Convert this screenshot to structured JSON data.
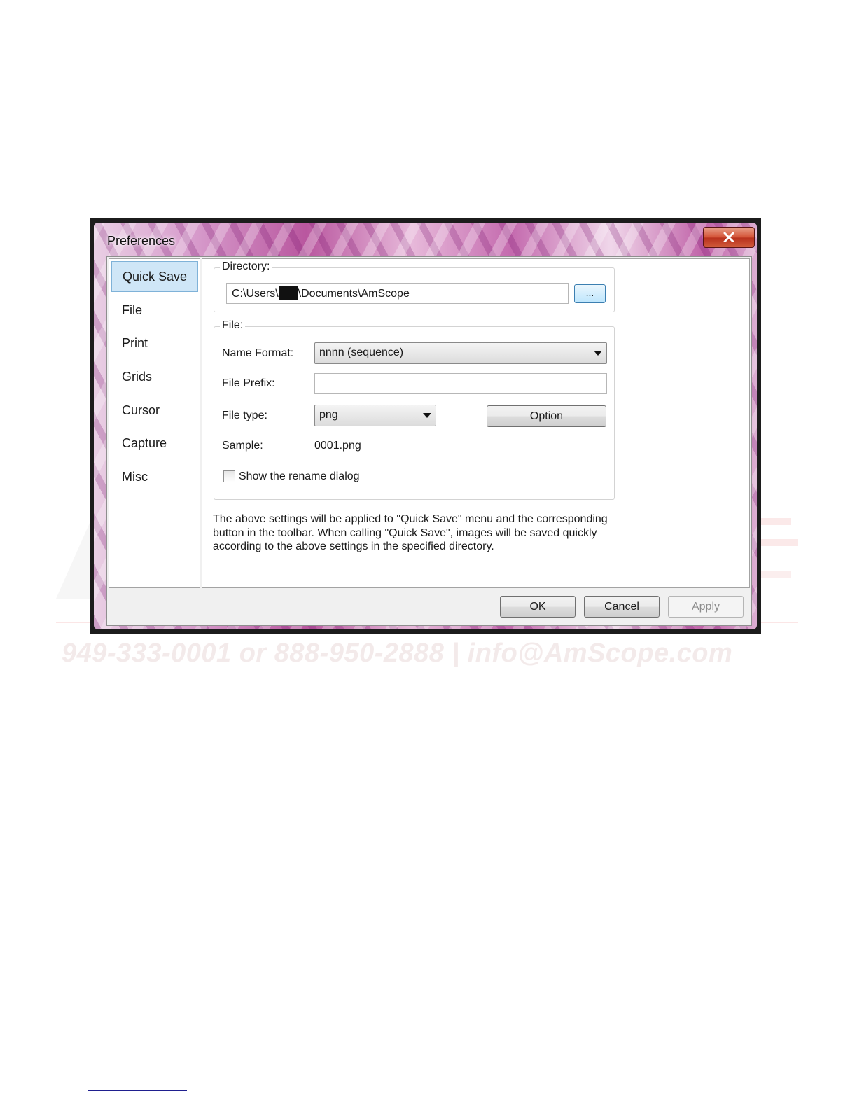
{
  "watermark": {
    "contact": "949-333-0001 or 888-950-2888 | info@AmScope.com"
  },
  "window": {
    "title": "Preferences",
    "close_icon": "close-x-icon"
  },
  "sidebar": {
    "items": [
      {
        "label": "Quick Save",
        "active": true
      },
      {
        "label": "File"
      },
      {
        "label": "Print"
      },
      {
        "label": "Grids"
      },
      {
        "label": "Cursor"
      },
      {
        "label": "Capture"
      },
      {
        "label": "Misc"
      }
    ]
  },
  "directory": {
    "group_label": "Directory:",
    "path_prefix": "C:\\Users\\",
    "path_suffix": "\\Documents\\AmScope",
    "browse_label": "..."
  },
  "file": {
    "group_label": "File:",
    "name_format_label": "Name Format:",
    "name_format_value": "nnnn (sequence)",
    "file_prefix_label": "File Prefix:",
    "file_prefix_value": "",
    "file_type_label": "File type:",
    "file_type_value": "png",
    "option_label": "Option",
    "sample_label": "Sample:",
    "sample_value": "0001.png",
    "rename_dialog_label": "Show the rename dialog",
    "rename_dialog_checked": false
  },
  "description": {
    "line1": "The above settings will be applied to \"Quick Save\" menu and the corresponding",
    "line2": "button in the toolbar. When calling \"Quick Save\", images will be saved quickly",
    "line3": "according to the above settings in the specified directory."
  },
  "footer": {
    "ok_label": "OK",
    "cancel_label": "Cancel",
    "apply_label": "Apply",
    "apply_enabled": false
  }
}
